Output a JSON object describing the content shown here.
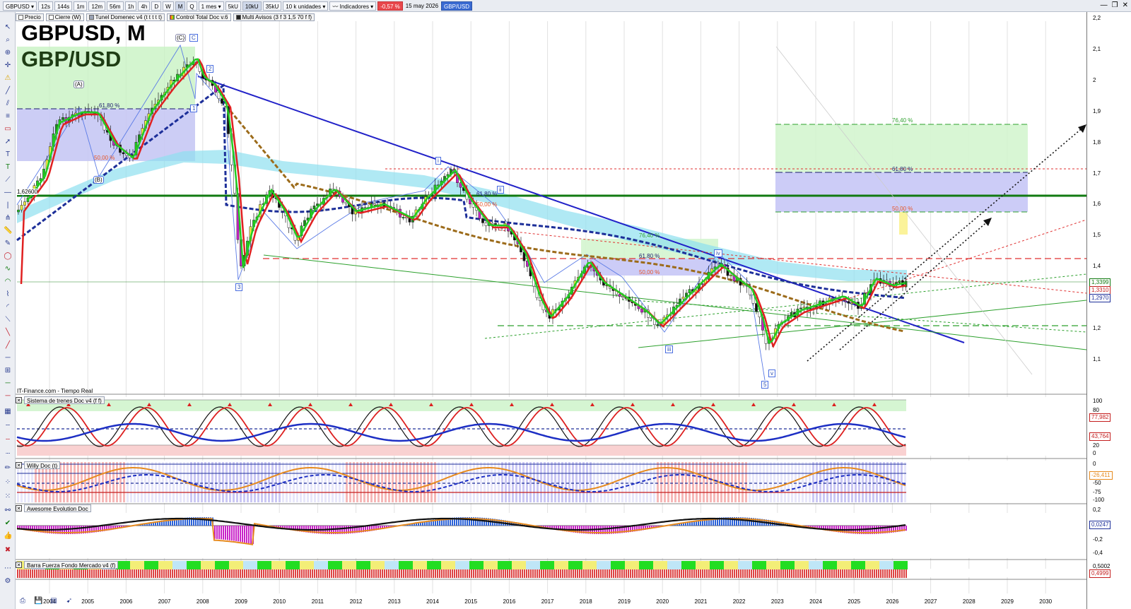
{
  "toolbar": {
    "symbol": "GBPUSD",
    "intervals": [
      "12s",
      "144s",
      "1m",
      "12m",
      "56m",
      "1h",
      "4h",
      "D",
      "W",
      "M",
      "Q"
    ],
    "selected_interval": "M",
    "period": "1 mes",
    "sizes": [
      "5kU",
      "10kU",
      "35kU"
    ],
    "selected_size": "10kU",
    "units": "10 k unidades",
    "indicators_label": "Indicadores",
    "change": "-0,57 %",
    "date": "15 may 2026",
    "pair": "GBP/USD"
  },
  "legend": [
    "Precio",
    "Cierre (W)",
    "Tunel Domenec v4 (t t t t t)",
    "Control Total Doc v.6",
    "Multi Avisos (3 f 3 1,5 70 f f)"
  ],
  "chart": {
    "title": "GBPUSD, M",
    "subtitle": "GBP/USD",
    "source": "IT-Finance.com - Tiempo Real",
    "level_label": "1,62600",
    "price_tags": [
      "1,3399",
      "1,3310",
      "1,2970"
    ],
    "fib_labels_right": [
      "76,40 %",
      "61,80 %",
      "50,00 %"
    ],
    "fib_labels_mid": [
      "76,40 %",
      "61,80 %",
      "50,00 %"
    ],
    "fib_labels_left": [
      "61,80 %",
      "50,00 %"
    ],
    "fib_labels_2014": [
      "61,80 %",
      "50,00 %"
    ],
    "wave_labels": [
      "(C)",
      "C",
      "(A)",
      "(B)",
      "2",
      "1",
      "3",
      "i",
      "ii",
      "iii",
      "iv",
      "v",
      "5"
    ],
    "y_axis": [
      "2,2",
      "2,1",
      "2",
      "1,9",
      "1,8",
      "1,7",
      "1,6",
      "1,5",
      "1,4",
      "1,3",
      "1,2",
      "1,1"
    ],
    "x_axis": [
      "2004",
      "2005",
      "2006",
      "2007",
      "2008",
      "2009",
      "2010",
      "2011",
      "2012",
      "2013",
      "2014",
      "2015",
      "2016",
      "2017",
      "2018",
      "2019",
      "2020",
      "2021",
      "2022",
      "2023",
      "2024",
      "2025",
      "2026",
      "2027",
      "2028",
      "2029",
      "2030"
    ],
    "colors": {
      "trend": "#2121c8",
      "support": "#117a11",
      "tunnel": "#66d4ee"
    }
  },
  "panels": {
    "trenes": {
      "label": "Sistema de trenes Doc v4 (f f)",
      "ticks": [
        "100",
        "80",
        "20",
        "0"
      ],
      "tags": [
        "77,982",
        "43,764"
      ]
    },
    "willy": {
      "label": "Willy Doc (t)",
      "ticks": [
        "0",
        "-50",
        "-75",
        "-100"
      ],
      "tags": [
        "-26,411"
      ]
    },
    "awesome": {
      "label": "Awesome Evolution Doc",
      "ticks": [
        "0,2",
        "0",
        "-0,2",
        "-0,4"
      ],
      "tags": [
        "0,0247"
      ]
    },
    "barra": {
      "label": "Barra Fuerza Fondo Mercado v4 (f)",
      "ticks": [
        "0,5002"
      ],
      "tags": [
        "0,4999"
      ]
    }
  }
}
